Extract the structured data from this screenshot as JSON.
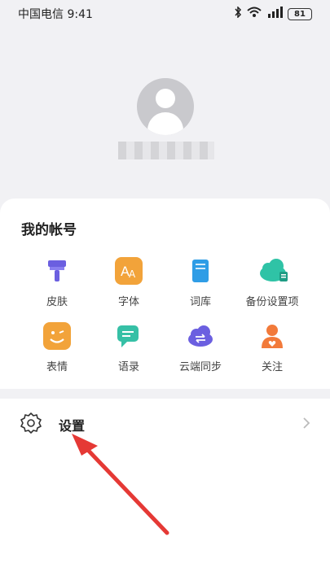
{
  "status": {
    "carrier_time": "中国电信 9:41",
    "battery": "81"
  },
  "account": {
    "section_title": "我的帐号",
    "items": [
      {
        "label": "皮肤",
        "icon": "brush-icon",
        "color": "#6b5fe0"
      },
      {
        "label": "字体",
        "icon": "font-icon",
        "color": "#f2a33a"
      },
      {
        "label": "词库",
        "icon": "book-icon",
        "color": "#2f9de6"
      },
      {
        "label": "备份设置项",
        "icon": "cloud-backup-icon",
        "color": "#2fc3a6"
      },
      {
        "label": "表情",
        "icon": "emoji-icon",
        "color": "#f2a33a"
      },
      {
        "label": "语录",
        "icon": "quote-chat-icon",
        "color": "#36c0a6"
      },
      {
        "label": "云端同步",
        "icon": "cloud-sync-icon",
        "color": "#6b5fe0"
      },
      {
        "label": "关注",
        "icon": "follow-person-icon",
        "color": "#f27a3a"
      }
    ]
  },
  "settings": {
    "label": "设置"
  }
}
